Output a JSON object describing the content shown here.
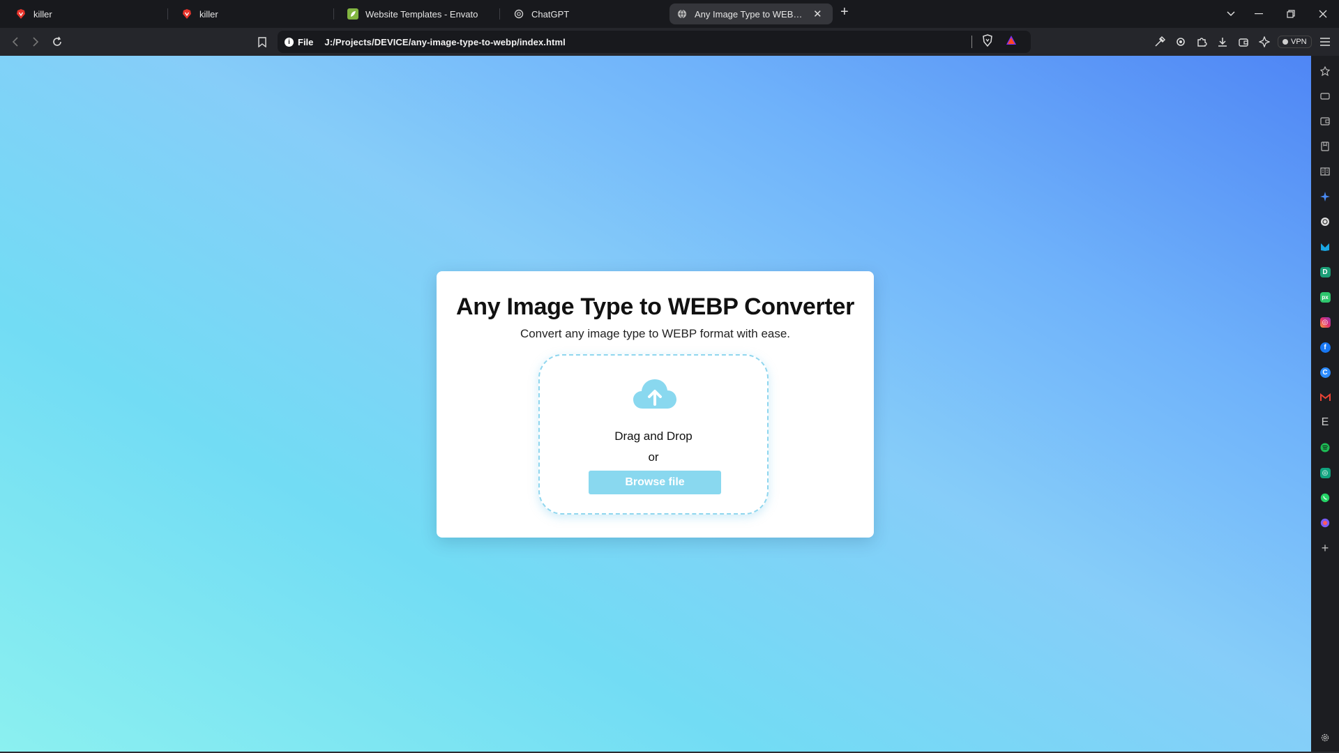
{
  "tabs": [
    {
      "title": "killer",
      "icon": "brave-lion-icon",
      "active": false
    },
    {
      "title": "killer",
      "icon": "brave-lion-icon",
      "active": false
    },
    {
      "title": "Website Templates - Envato",
      "icon": "envato-leaf-icon",
      "active": false
    },
    {
      "title": "ChatGPT",
      "icon": "openai-icon",
      "active": false
    },
    {
      "title": "Any Image Type to WEBP Conve",
      "icon": "globe-icon",
      "active": true
    }
  ],
  "toolbar": {
    "scheme_label": "File",
    "url": "J:/Projects/DEVICE/any-image-type-to-webp/index.html",
    "vpn_label": "VPN"
  },
  "page": {
    "title": "Any Image Type to WEBP Converter",
    "subtitle": "Convert any image type to WEBP format with ease.",
    "drop_text": "Drag and Drop",
    "or_text": "or",
    "browse_label": "Browse file"
  },
  "colors": {
    "accent": "#89d8ef",
    "dropzone_border": "#8fd6ee",
    "bg_gradient_start": "#8bf0f0",
    "bg_gradient_end": "#4f86f5"
  },
  "sidebar_icons": [
    "star-icon",
    "video-icon",
    "wallet-icon",
    "bookmark-icon",
    "reading-list-icon",
    "leo-ai-icon",
    "openai-icon",
    "malwarebytes-icon",
    "dribbble-icon",
    "pixabay-icon",
    "instagram-icon",
    "facebook-icon",
    "chrome-icon",
    "gmail-icon",
    "envato-icon",
    "spotify-icon",
    "chatgpt-icon",
    "whatsapp-icon",
    "messenger-icon",
    "add-panel-icon",
    "settings-icon"
  ]
}
